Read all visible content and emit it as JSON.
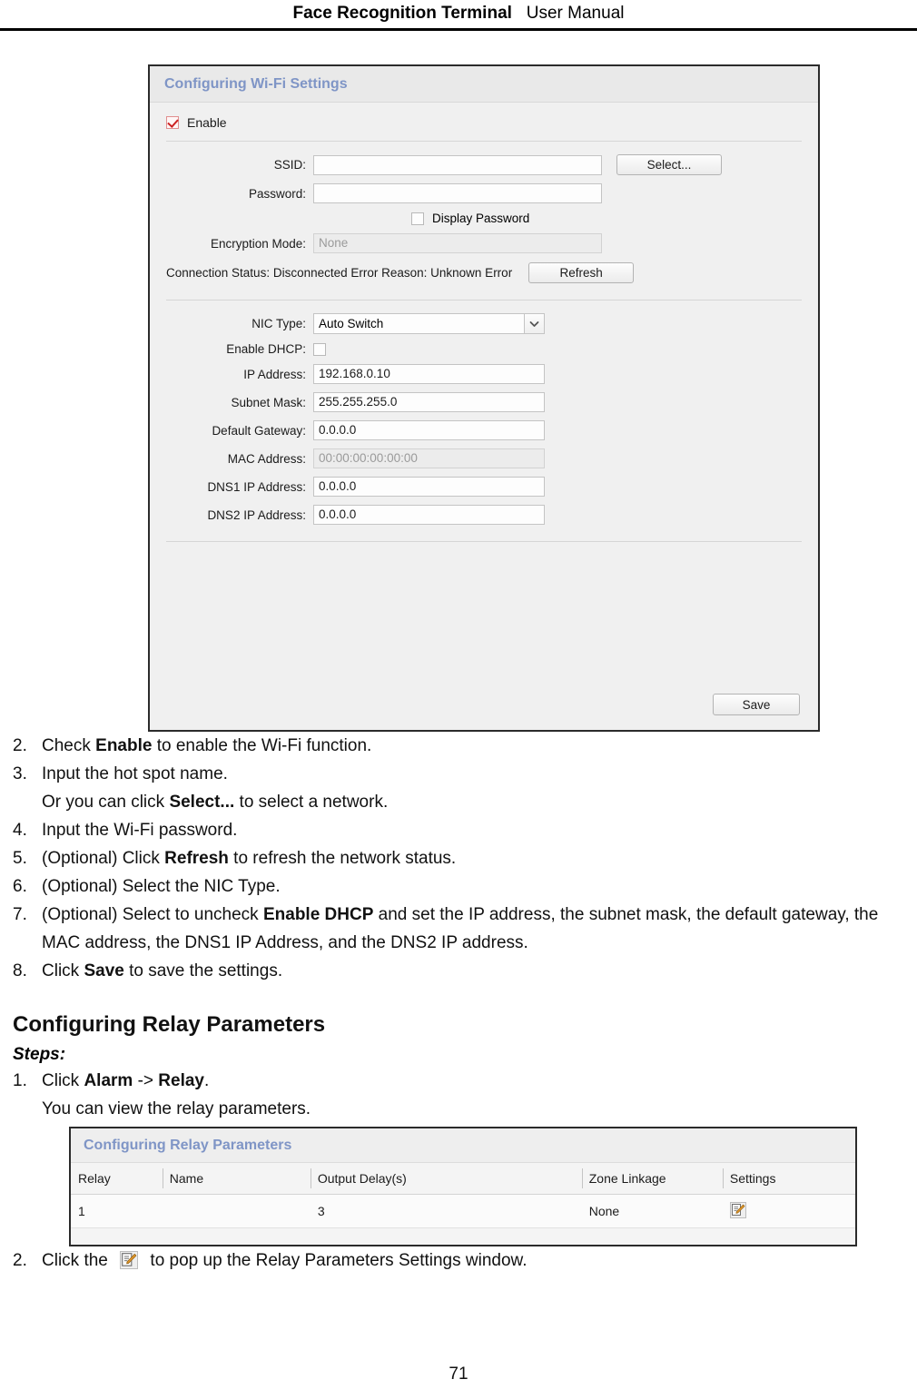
{
  "header": {
    "title_bold": "Face Recognition Terminal",
    "title_light": "User Manual"
  },
  "wifi_panel": {
    "panel_title": "Configuring Wi-Fi Settings",
    "enable_label": "Enable",
    "enable_checked": true,
    "ssid_label": "SSID:",
    "ssid_value": "",
    "select_button": "Select...",
    "password_label": "Password:",
    "password_value": "",
    "display_password_label": "Display Password",
    "display_password_checked": false,
    "encryption_label": "Encryption Mode:",
    "encryption_value": "None",
    "status_text": "Connection Status:  Disconnected  Error Reason:  Unknown Error",
    "refresh_button": "Refresh",
    "nic_type_label": "NIC Type:",
    "nic_type_value": "Auto Switch",
    "enable_dhcp_label": "Enable DHCP:",
    "enable_dhcp_checked": false,
    "ip_address_label": "IP Address:",
    "ip_address_value": "192.168.0.10",
    "subnet_mask_label": "Subnet Mask:",
    "subnet_mask_value": "255.255.255.0",
    "default_gateway_label": "Default Gateway:",
    "default_gateway_value": "0.0.0.0",
    "mac_address_label": "MAC Address:",
    "mac_address_value": "00:00:00:00:00:00",
    "dns1_label": "DNS1 IP Address:",
    "dns1_value": "0.0.0.0",
    "dns2_label": "DNS2 IP Address:",
    "dns2_value": "0.0.0.0",
    "save_button": "Save"
  },
  "wifi_steps": [
    {
      "num": "2.",
      "pre": "Check ",
      "bold": "Enable",
      "post": " to enable the Wi-Fi function."
    },
    {
      "num": "3.",
      "pre": "Input the hot spot name.",
      "bold": "",
      "post": ""
    },
    {
      "num": "4.",
      "pre": "Input the Wi-Fi password.",
      "bold": "",
      "post": ""
    },
    {
      "num": "5.",
      "pre": "(Optional) Click ",
      "bold": "Refresh",
      "post": " to refresh the network status."
    },
    {
      "num": "6.",
      "pre": "(Optional) Select the NIC Type.",
      "bold": "",
      "post": ""
    },
    {
      "num": "7.",
      "pre": "(Optional) Select to uncheck ",
      "bold": "Enable DHCP",
      "post": " and set the IP address, the subnet mask, the default gateway, the MAC address, the DNS1 IP Address, and the DNS2 IP address."
    },
    {
      "num": "8.",
      "pre": "Click ",
      "bold": "Save",
      "post": " to save the settings."
    }
  ],
  "wifi_substep_3": {
    "pre": "Or you can click ",
    "bold": "Select...",
    "post": " to select a network."
  },
  "relay_section": {
    "heading": "Configuring Relay Parameters",
    "steps_lead": "Steps:",
    "step1_num": "1.",
    "step1_pre": "Click ",
    "step1_bold1": "Alarm",
    "step1_mid": " -> ",
    "step1_bold2": "Relay",
    "step1_post": ".",
    "step1_sub": "You can view the relay parameters.",
    "step2_num": "2.",
    "step2_pre": "Click the ",
    "step2_post": " to pop up the Relay Parameters Settings window."
  },
  "relay_panel": {
    "panel_title": "Configuring Relay Parameters",
    "columns": [
      "Relay",
      "Name",
      "Output Delay(s)",
      "Zone Linkage",
      "Settings"
    ],
    "rows": [
      {
        "relay": "1",
        "name": "",
        "delay": "3",
        "zone": "None",
        "settings_icon": "edit-icon"
      }
    ]
  },
  "footer": {
    "page_number": "71"
  }
}
